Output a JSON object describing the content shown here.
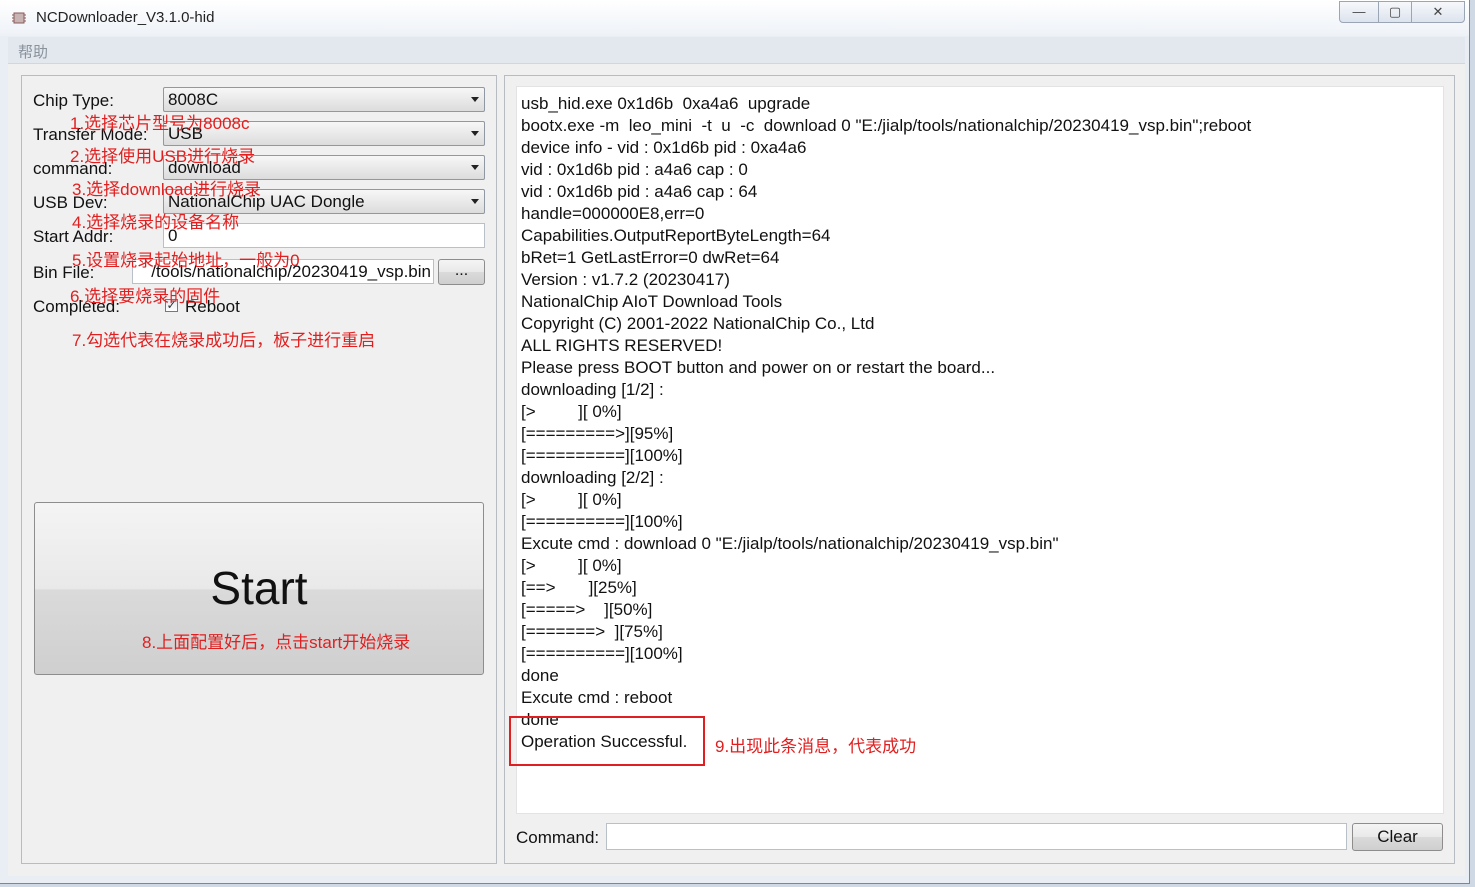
{
  "window": {
    "title": "NCDownloader_V3.1.0-hid",
    "minimize_glyph": "—",
    "maximize_glyph": "▢",
    "close_glyph": "✕"
  },
  "menu": {
    "help": "帮助"
  },
  "settings": {
    "chip_type_label": "Chip Type:",
    "chip_type_value": "8008C",
    "transfer_mode_label": "Transfer Mode:",
    "transfer_mode_value": "USB",
    "command_label": "command:",
    "command_value": "download",
    "usb_dev_label": "USB Dev:",
    "usb_dev_value": "NationalChip UAC Dongle",
    "start_addr_label": "Start Addr:",
    "start_addr_value": "0",
    "bin_file_label": "Bin File:",
    "bin_file_value": "/tools/nationalchip/20230419_vsp.bin",
    "browse_label": "...",
    "completed_label": "Completed:",
    "reboot_label": "Reboot",
    "reboot_checked": true
  },
  "start_button": {
    "label": "Start"
  },
  "annotations": {
    "n1": "1.选择芯片型号为8008c",
    "n2": "2.选择使用USB进行烧录",
    "n3": "3.选择download进行烧录",
    "n4": "4.选择烧录的设备名称",
    "n5": "5.设置烧录起始地址，一般为0",
    "n6": "6.选择要烧录的固件",
    "n7": "7.勾选代表在烧录成功后，板子进行重启",
    "n8": "8.上面配置好后，点击start开始烧录",
    "n9": "9.出现此条消息，代表成功"
  },
  "log": {
    "lines": [
      "usb_hid.exe 0x1d6b  0xa4a6  upgrade",
      "bootx.exe -m  leo_mini  -t  u  -c  download 0 \"E:/jialp/tools/nationalchip/20230419_vsp.bin\";reboot",
      "device info - vid : 0x1d6b pid : 0xa4a6",
      "vid : 0x1d6b pid : a4a6 cap : 0",
      "vid : 0x1d6b pid : a4a6 cap : 64",
      "handle=000000E8,err=0",
      "Capabilities.OutputReportByteLength=64",
      "bRet=1 GetLastError=0 dwRet=64",
      "Version : v1.7.2 (20230417)",
      "NationalChip AIoT Download Tools",
      "Copyright (C) 2001-2022 NationalChip Co., Ltd",
      "ALL RIGHTS RESERVED!",
      "Please press BOOT button and power on or restart the board...",
      "downloading [1/2] :",
      "[>         ][ 0%]",
      "[=========>][95%]",
      "[==========][100%]",
      "downloading [2/2] :",
      "[>         ][ 0%]",
      "[==========][100%]",
      "Excute cmd : download 0 \"E:/jialp/tools/nationalchip/20230419_vsp.bin\"",
      "[>         ][ 0%]",
      "[==>       ][25%]",
      "[=====>    ][50%]",
      "[=======>  ][75%]",
      "[==========][100%]",
      "done",
      "Excute cmd : reboot",
      "done",
      "Operation Successful."
    ]
  },
  "command_bar": {
    "label": "Command:",
    "value": "",
    "clear_label": "Clear"
  }
}
